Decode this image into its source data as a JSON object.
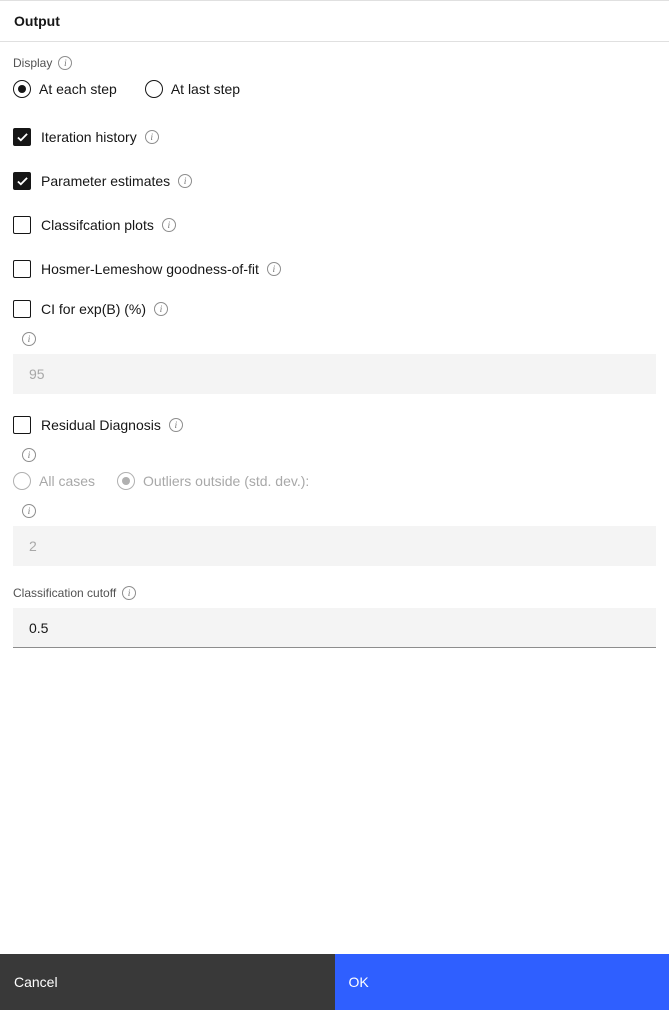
{
  "header": {
    "title": "Output"
  },
  "display": {
    "label": "Display",
    "at_each_step": "At each step",
    "at_last_step": "At last step"
  },
  "options": {
    "iteration_history": "Iteration history",
    "parameter_estimates": "Parameter estimates",
    "classification_plots": "Classifcation plots",
    "hosmer_lemeshow": "Hosmer-Lemeshow goodness-of-fit",
    "ci_for_expb": "CI for exp(B) (%)",
    "ci_value": "95",
    "residual_diagnosis": "Residual Diagnosis",
    "all_cases": "All cases",
    "outliers_outside": "Outliers outside (std. dev.):",
    "outliers_value": "2"
  },
  "classification_cutoff": {
    "label": "Classification cutoff",
    "value": "0.5"
  },
  "footer": {
    "cancel": "Cancel",
    "ok": "OK"
  }
}
